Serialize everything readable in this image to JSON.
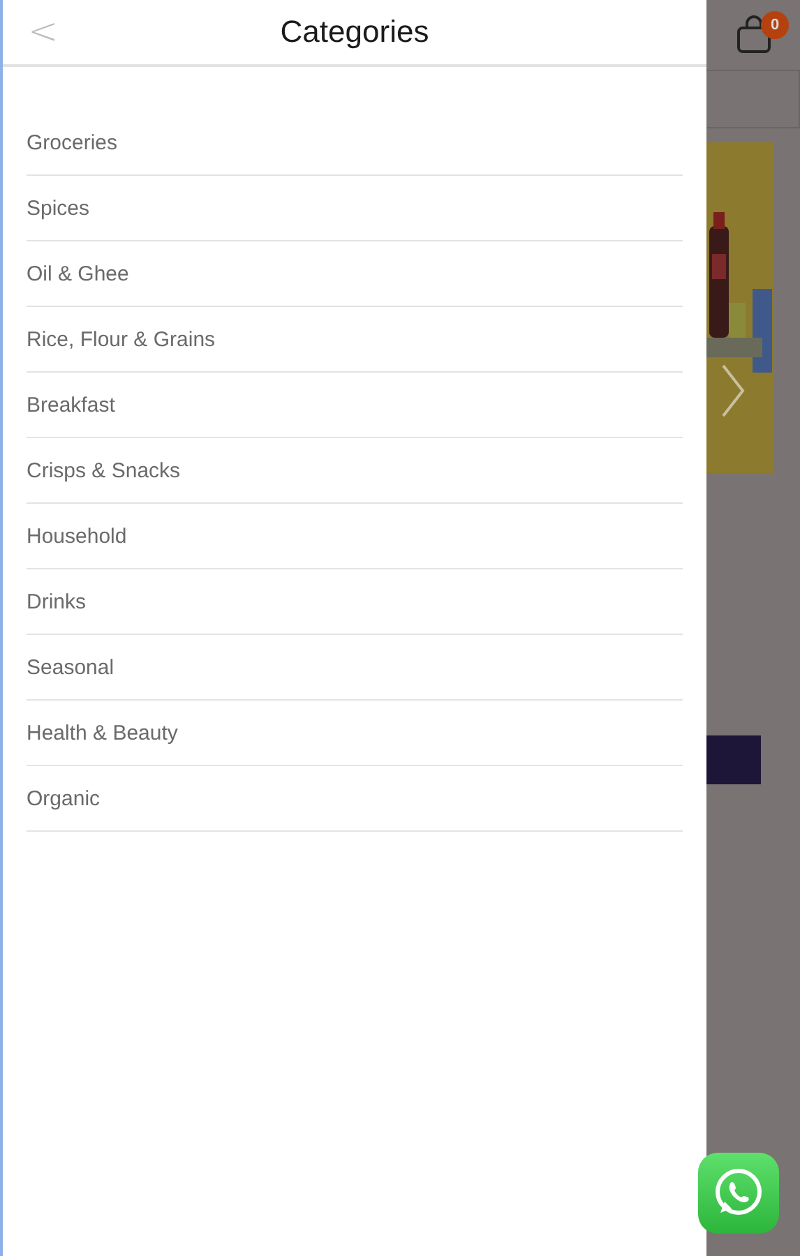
{
  "drawer": {
    "title": "Categories",
    "back": "<"
  },
  "categories": [
    "Groceries",
    "Spices",
    "Oil & Ghee",
    "Rice, Flour & Grains",
    "Breakfast",
    "Crisps & Snacks",
    "Household",
    "Drinks",
    "Seasonal",
    "Health & Beauty",
    "Organic"
  ],
  "cart": {
    "count": "0"
  }
}
